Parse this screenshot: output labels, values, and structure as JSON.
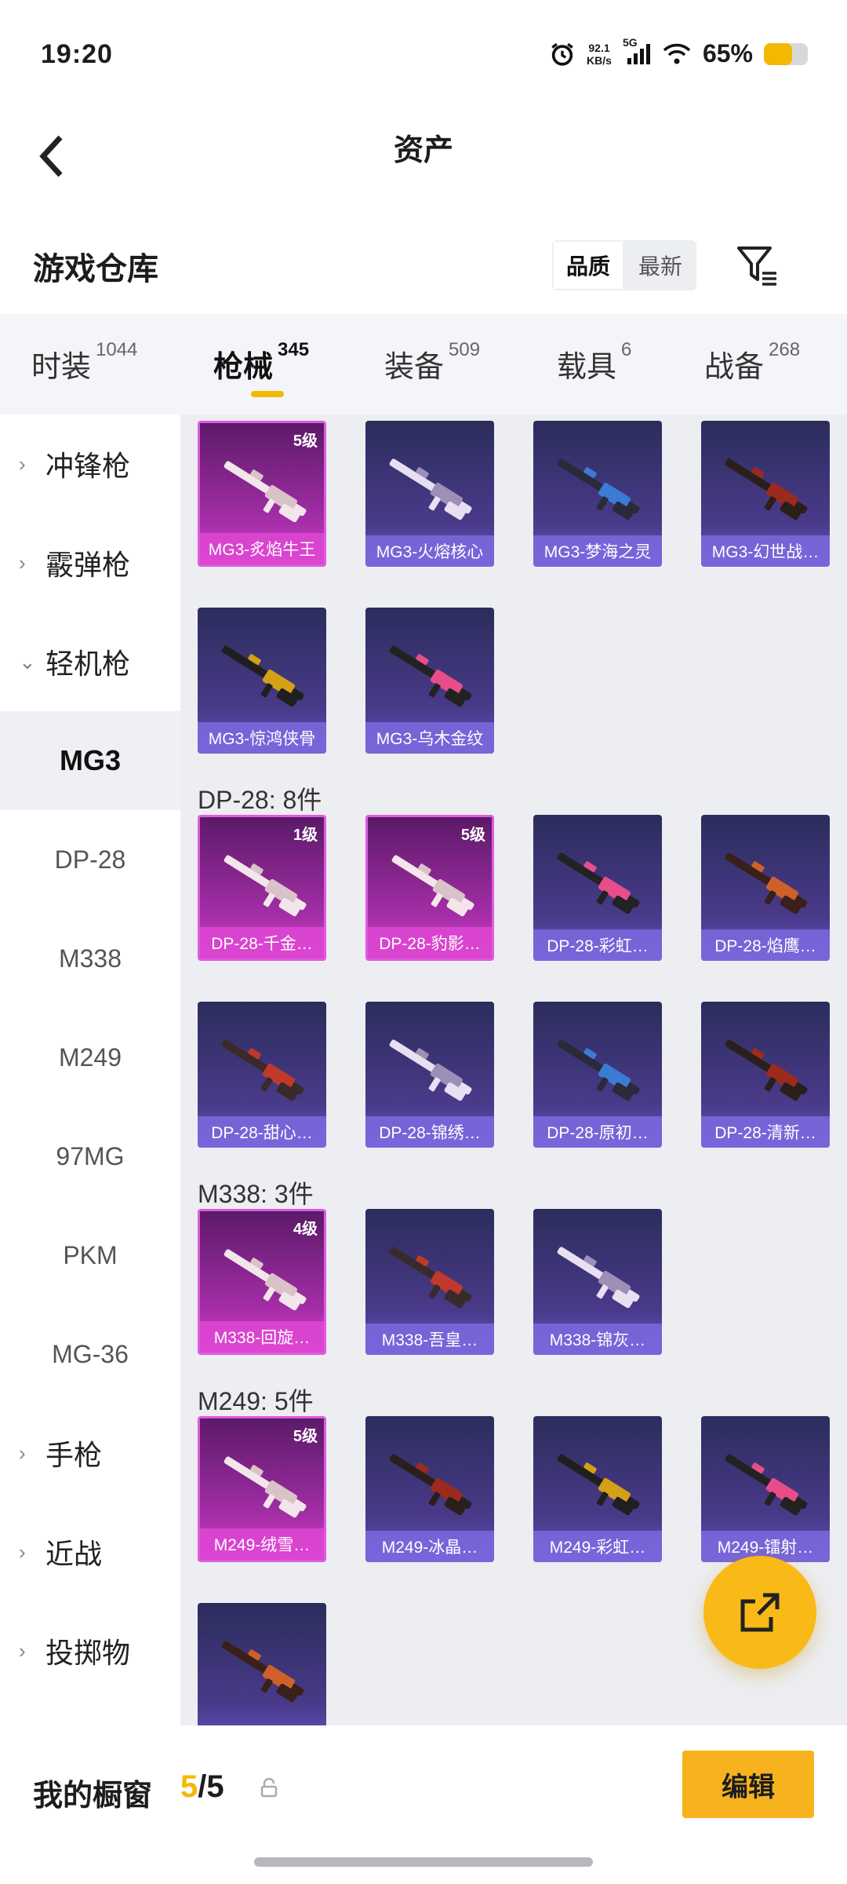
{
  "status_bar": {
    "time": "19:20",
    "speed_value": "92.1",
    "speed_unit": "KB/s",
    "network": "5G",
    "battery_percent": "65%",
    "battery_level": 0.65
  },
  "header": {
    "title": "资产"
  },
  "warehouse": {
    "title": "游戏仓库",
    "sort_options": [
      "品质",
      "最新"
    ],
    "sort_selected": "品质"
  },
  "tabs": [
    {
      "label": "时装",
      "count": "1044"
    },
    {
      "label": "枪械",
      "count": "345",
      "active": true
    },
    {
      "label": "装备",
      "count": "509"
    },
    {
      "label": "载具",
      "count": "6"
    },
    {
      "label": "战备",
      "count": "268"
    }
  ],
  "sidebar": [
    {
      "label": "冲锋枪",
      "type": "category",
      "chevron": "›"
    },
    {
      "label": "霰弹枪",
      "type": "category",
      "chevron": "›"
    },
    {
      "label": "轻机枪",
      "type": "category",
      "chevron": "⌄"
    },
    {
      "label": "MG3",
      "type": "sub",
      "selected": true
    },
    {
      "label": "DP-28",
      "type": "sub"
    },
    {
      "label": "M338",
      "type": "sub"
    },
    {
      "label": "M249",
      "type": "sub"
    },
    {
      "label": "97MG",
      "type": "sub"
    },
    {
      "label": "PKM",
      "type": "sub"
    },
    {
      "label": "MG-36",
      "type": "sub"
    },
    {
      "label": "手枪",
      "type": "category",
      "chevron": "›"
    },
    {
      "label": "近战",
      "type": "category",
      "chevron": "›"
    },
    {
      "label": "投掷物",
      "type": "category",
      "chevron": "›"
    }
  ],
  "groups": [
    {
      "title": "",
      "items": [
        {
          "name": "MG3-炙焰牛王",
          "level": "5级",
          "rarity": "pink"
        },
        {
          "name": "MG3-火熔核心",
          "rarity": "purple"
        },
        {
          "name": "MG3-梦海之灵",
          "rarity": "purple"
        },
        {
          "name": "MG3-幻世战…",
          "rarity": "purple"
        },
        {
          "name": "MG3-惊鸿侠骨",
          "rarity": "purple"
        },
        {
          "name": "MG3-乌木金纹",
          "rarity": "purple"
        }
      ]
    },
    {
      "title": "DP-28: 8件",
      "items": [
        {
          "name": "DP-28-千金…",
          "level": "1级",
          "rarity": "pink"
        },
        {
          "name": "DP-28-豹影…",
          "level": "5级",
          "rarity": "pink"
        },
        {
          "name": "DP-28-彩虹…",
          "rarity": "purple"
        },
        {
          "name": "DP-28-焰鹰…",
          "rarity": "purple"
        },
        {
          "name": "DP-28-甜心…",
          "rarity": "purple"
        },
        {
          "name": "DP-28-锦绣…",
          "rarity": "purple"
        },
        {
          "name": "DP-28-原初…",
          "rarity": "purple"
        },
        {
          "name": "DP-28-清新…",
          "rarity": "purple"
        }
      ]
    },
    {
      "title": "M338: 3件",
      "items": [
        {
          "name": "M338-回旋…",
          "level": "4级",
          "rarity": "pink"
        },
        {
          "name": "M338-吾皇…",
          "rarity": "purple"
        },
        {
          "name": "M338-锦灰…",
          "rarity": "purple"
        }
      ]
    },
    {
      "title": "M249: 5件",
      "items": [
        {
          "name": "M249-绒雪…",
          "level": "5级",
          "rarity": "pink"
        },
        {
          "name": "M249-冰晶…",
          "rarity": "purple"
        },
        {
          "name": "M249-彩虹…",
          "rarity": "purple"
        },
        {
          "name": "M249-镭射…",
          "rarity": "purple"
        },
        {
          "name": "",
          "rarity": "purple"
        }
      ]
    }
  ],
  "bottom": {
    "label": "我的橱窗",
    "current": "5",
    "total": "/5",
    "edit_label": "编辑"
  },
  "icons": {
    "back": "chevron-left-icon",
    "filter": "filter-icon",
    "share": "share-external-icon",
    "lock": "lock-icon"
  }
}
